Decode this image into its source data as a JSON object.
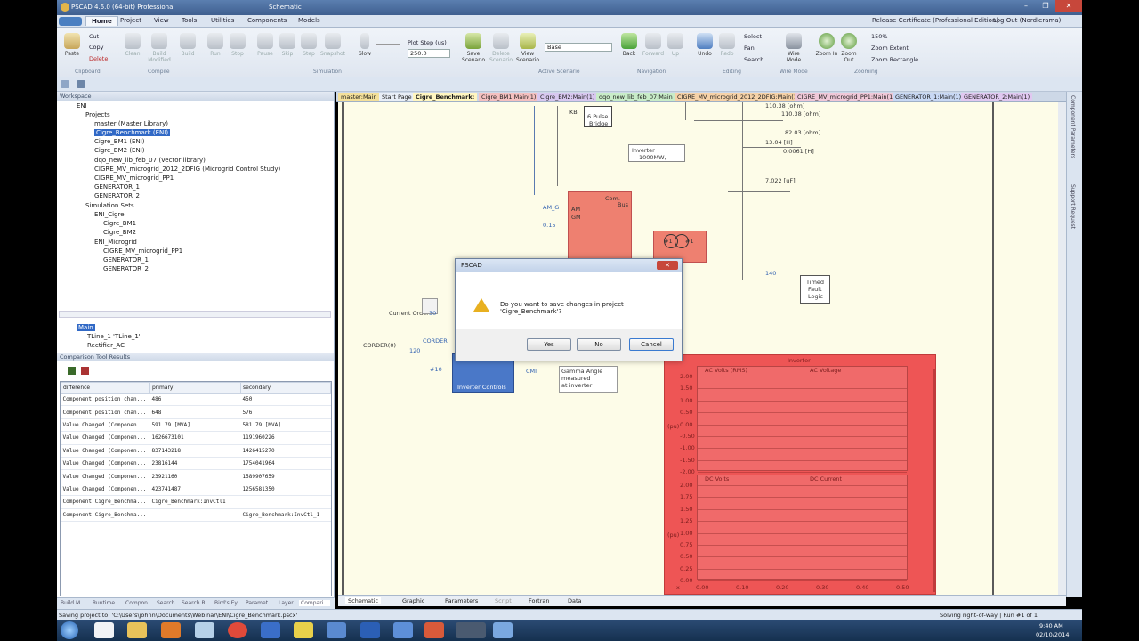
{
  "window": {
    "title": "PSCAD 4.6.0 (64-bit) Professional",
    "subtitle": "Schematic",
    "license": "Release Certificate (Professional Edition)",
    "logout": "Log Out (Nordlerama)"
  },
  "ribbon": {
    "tabs": [
      "Home",
      "Project",
      "View",
      "Tools",
      "Utilities",
      "Components",
      "Models"
    ],
    "clipboard": {
      "paste": "Paste",
      "cut": "Cut",
      "copy": "Copy",
      "delete": "Delete",
      "group": "Clipboard"
    },
    "compile": {
      "clean": "Clean",
      "build_modified": "Build Modified",
      "build": "Build",
      "group": "Compile"
    },
    "simulation": {
      "run": "Run",
      "stop": "Stop",
      "pause": "Pause",
      "skip": "Skip",
      "step": "Step",
      "snapshot": "Snapshot",
      "slow": "Slow",
      "plot_step_label": "Plot Step (us)",
      "plot_step": "250.0",
      "group": "Simulation"
    },
    "scenario": {
      "save": "Save Scenario",
      "delete": "Delete Scenario",
      "view": "View Scenario",
      "base": "Base",
      "group": "Active Scenario"
    },
    "navigation": {
      "back": "Back",
      "forward": "Forward",
      "up": "Up",
      "group": "Navigation"
    },
    "editing": {
      "undo": "Undo",
      "redo": "Redo",
      "select": "Select",
      "pan": "Pan",
      "search": "Search",
      "group": "Editing"
    },
    "wire": {
      "wire_mode": "Wire Mode",
      "group": "Wire Mode"
    },
    "zooming": {
      "zoom_in": "Zoom In",
      "zoom_out": "Zoom Out",
      "zoom_level": "150%",
      "zoom_extent": "Zoom Extent",
      "zoom_rect": "Zoom Rectangle",
      "group": "Zooming"
    }
  },
  "workspace": {
    "header": "Workspace",
    "root": "ENI",
    "projects_label": "Projects",
    "projects": [
      "master (Master Library)",
      "Cigre_Benchmark (ENI)",
      "Cigre_BM1 (ENI)",
      "Cigre_BM2 (ENI)",
      "dqo_new_lib_feb_07 (Vector library)",
      "CIGRE_MV_microgrid_2012_2DFIG (Microgrid Control Study)",
      "CIGRE_MV_microgrid_PP1",
      "GENERATOR_1",
      "GENERATOR_2"
    ],
    "simsets_label": "Simulation Sets",
    "simset1": "ENI_Cigre",
    "simset1_items": [
      "Cigre_BM1",
      "Cigre_BM2"
    ],
    "simset2": "ENI_Microgrid",
    "simset2_items": [
      "CIGRE_MV_microgrid_PP1",
      "GENERATOR_1",
      "GENERATOR_2"
    ]
  },
  "defn_tree": {
    "main": "Main",
    "items": [
      "TLine_1 'TLine_1'",
      "Rectifier_AC"
    ]
  },
  "comparison": {
    "header": "Comparison Tool Results",
    "columns": [
      "difference",
      "primary",
      "secondary"
    ],
    "rows": [
      [
        "Component position chan...",
        "486",
        "450"
      ],
      [
        "Component position chan...",
        "648",
        "576"
      ],
      [
        "Value Changed (Componen...",
        "591.79 [MVA]",
        "581.79 [MVA]"
      ],
      [
        "Value Changed (Componen...",
        "1626673101",
        "1191960226"
      ],
      [
        "Value Changed (Componen...",
        "837143218",
        "1426415270"
      ],
      [
        "Value Changed (Componen...",
        "23816144",
        "1754041964"
      ],
      [
        "Value Changed (Componen...",
        "23921160",
        "1589907659"
      ],
      [
        "Value Changed (Componen...",
        "423741487",
        "1256581350"
      ],
      [
        "Component Cigre_Benchma...",
        "Cigre_Benchmark:InvCtl1",
        ""
      ],
      [
        "Component Cigre_Benchma...",
        "",
        "Cigre_Benchmark:InvCtl_1"
      ]
    ]
  },
  "bottom_tabs": [
    "Build M...",
    "Runtime...",
    "Compon...",
    "Search",
    "Search R...",
    "Bird's Ey...",
    "Paramet...",
    "Layer",
    "Compari..."
  ],
  "doc_tabs": [
    "master:Main",
    "Start Page",
    "Cigre_Benchmark:",
    "Cigre_BM1:Main(1)",
    "Cigre_BM2:Main(1)",
    "dqo_new_lib_feb_07:Main",
    "CIGRE_MV_microgrid_2012_2DFIG:Main(1)",
    "CIGRE_MV_microgrid_PP1:Main(1)",
    "GENERATOR_1:Main(1)",
    "GENERATOR_2:Main(1)"
  ],
  "right_tabs": [
    "Component Parameters",
    "Support Request"
  ],
  "schematic": {
    "labels": {
      "pulse": "6 Pulse",
      "bridge": "Bridge",
      "kb": "KB",
      "inverter_box1": "Inverter",
      "inverter_box2": "1000MW,",
      "am": "AM",
      "gm": "GM",
      "am2": "AM",
      "amg": "AM_G",
      "val1": "0.15",
      "com_bus1": "Com.",
      "com_bus2": "Bus",
      "t1": "#1",
      "t2": "#1",
      "r1": "110.38 [ohm]",
      "r2": "82.03 [ohm]",
      "l1": "13.04 [H]",
      "l2": "0.0061 [H]",
      "c1": "7.022 [uF]",
      "timed1": "Timed",
      "timed2": "Fault",
      "timed3": "Logic",
      "current_order": "Current Order",
      "corder_in": "CORDER(0)",
      "corder": "CORDER",
      "n120": "120",
      "n1": "1",
      "inv_controls": "Inverter Controls",
      "cmi": "CMI",
      "gamma1": "Gamma Angle",
      "gamma2": "measured",
      "gamma3": "at inverter",
      "n30": "30",
      "n10": "#10",
      "n140": "140"
    },
    "plot_title": "Inverter",
    "graph1": {
      "curves": [
        "AC Volts (RMS)",
        "AC Voltage"
      ],
      "ylabel": "(pu)",
      "yticks": [
        "2.00",
        "1.50",
        "1.00",
        "0.50",
        "0.00",
        "-0.50",
        "-1.00",
        "-1.50",
        "-2.00"
      ]
    },
    "graph2": {
      "curves": [
        "DC Volts",
        "DC Current"
      ],
      "ylabel": "(pu)",
      "yticks": [
        "2.00",
        "1.75",
        "1.50",
        "1.25",
        "1.00",
        "0.75",
        "0.50",
        "0.25",
        "0.00"
      ]
    },
    "xticks": [
      "x",
      "0.00",
      "0.10",
      "0.20",
      "0.30",
      "0.40",
      "0.50"
    ]
  },
  "dialog": {
    "title": "PSCAD",
    "message": "Do you want to save changes in project 'Cigre_Benchmark'?",
    "yes": "Yes",
    "no": "No",
    "cancel": "Cancel"
  },
  "sheet_tabs": [
    "Schematic",
    "Graphic",
    "Parameters",
    "Script",
    "Fortran",
    "Data"
  ],
  "status": {
    "left": "Saving project to: 'C:\\Users\\johnn\\Documents\\Webinar\\ENI\\Cigre_Benchmark.pscx'",
    "right": "Solving right-of-way | Run #1 of 1"
  },
  "taskbar": {
    "time": "9:40 AM",
    "date": "02/10/2014"
  },
  "colors": {
    "accent": "#3169c6",
    "plot_red": "#ee5555",
    "canvas": "#fdfce8"
  }
}
